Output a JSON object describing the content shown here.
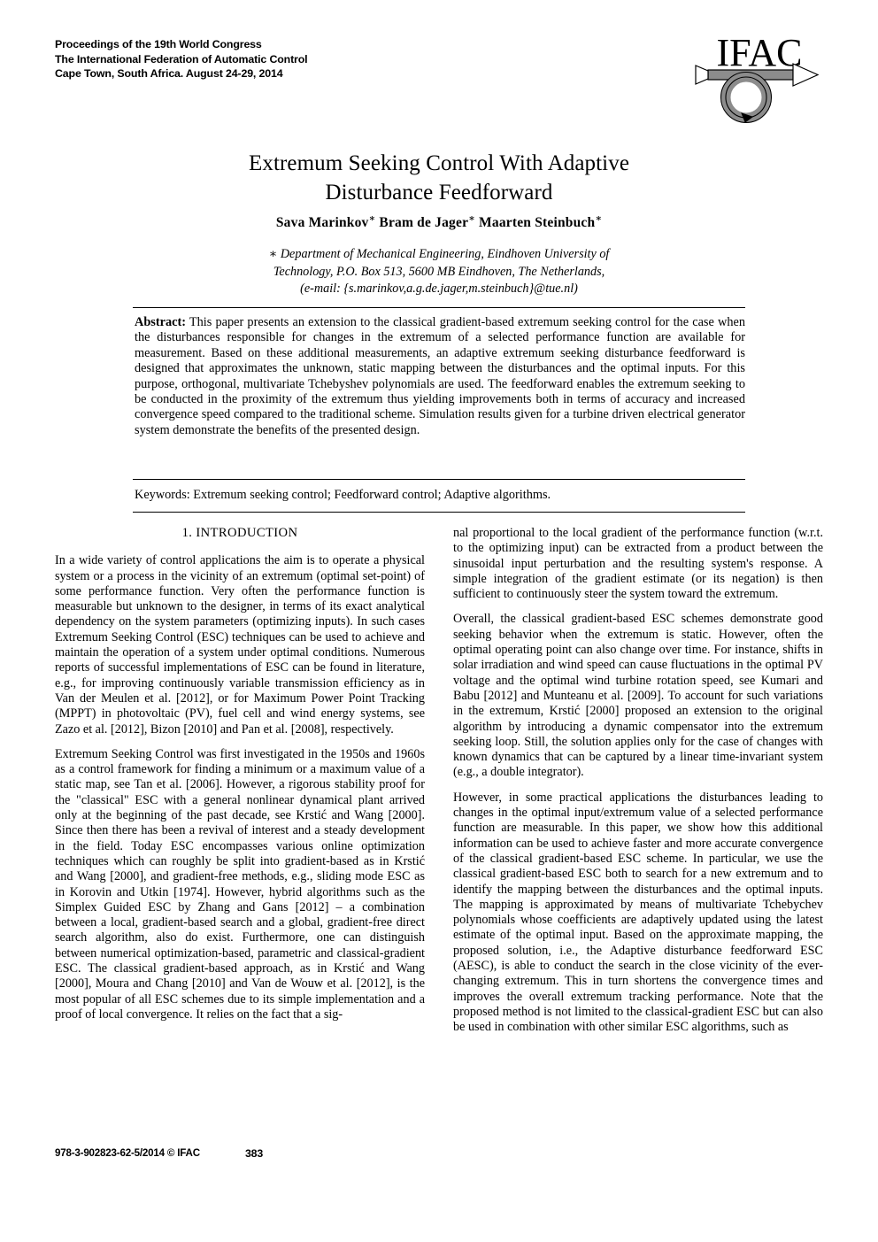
{
  "header": {
    "line1": "Proceedings of the 19th World Congress",
    "line2": "The International Federation of Automatic Control",
    "line3": "Cape Town, South Africa. August 24-29, 2014",
    "logo_text": "IFAC"
  },
  "title": {
    "line1": "Extremum Seeking Control With Adaptive",
    "line2": "Disturbance Feedforward"
  },
  "authors": {
    "list": "Sava Marinkov * Bram de Jager * Maarten Steinbuch *",
    "name1": "Sava Marinkov",
    "name2": "Bram de Jager",
    "name3": "Maarten Steinbuch",
    "marker": "∗"
  },
  "affiliation": {
    "line1": "∗ Department of Mechanical Engineering, Eindhoven University of",
    "line2": "Technology, P.O. Box 513, 5600 MB Eindhoven, The Netherlands,",
    "line3": "(e-mail: {s.marinkov,a.g.de.jager,m.steinbuch}@tue.nl)"
  },
  "abstract": {
    "label": "Abstract:",
    "text": " This paper presents an extension to the classical gradient-based extremum seeking control for the case when the disturbances responsible for changes in the extremum of a selected performance function are available for measurement. Based on these additional measurements, an adaptive extremum seeking disturbance feedforward is designed that approximates the unknown, static mapping between the disturbances and the optimal inputs. For this purpose, orthogonal, multivariate Tchebyshev polynomials are used. The feedforward enables the extremum seeking to be conducted in the proximity of the extremum thus yielding improvements both in terms of accuracy and increased convergence speed compared to the traditional scheme. Simulation results given for a turbine driven electrical generator system demonstrate the benefits of the presented design."
  },
  "keywords": {
    "text": "Keywords: Extremum seeking control; Feedforward control; Adaptive algorithms."
  },
  "left_column": {
    "section_heading": "1. INTRODUCTION",
    "paragraphs": [
      "In a wide variety of control applications the aim is to operate a physical system or a process in the vicinity of an extremum (optimal set-point) of some performance function. Very often the performance function is measurable but unknown to the designer, in terms of its exact analytical dependency on the system parameters (optimizing inputs). In such cases Extremum Seeking Control (ESC) techniques can be used to achieve and maintain the operation of a system under optimal conditions. Numerous reports of successful implementations of ESC can be found in literature, e.g., for improving continuously variable transmission efficiency as in Van der Meulen et al. [2012], or for Maximum Power Point Tracking (MPPT) in photovoltaic (PV), fuel cell and wind energy systems, see Zazo et al. [2012], Bizon [2010] and Pan et al. [2008], respectively.",
      "Extremum Seeking Control was first investigated in the 1950s and 1960s as a control framework for finding a minimum or a maximum value of a static map, see Tan et al. [2006]. However, a rigorous stability proof for the \"classical\" ESC with a general nonlinear dynamical plant arrived only at the beginning of the past decade, see Krstić and Wang [2000]. Since then there has been a revival of interest and a steady development in the field. Today ESC encompasses various online optimization techniques which can roughly be split into gradient-based as in Krstić and Wang [2000], and gradient-free methods, e.g., sliding mode ESC as in Korovin and Utkin [1974]. However, hybrid algorithms such as the Simplex Guided ESC by Zhang and Gans [2012] – a combination between a local, gradient-based search and a global, gradient-free direct search algorithm, also do exist. Furthermore, one can distinguish between numerical optimization-based, parametric and classical-gradient ESC. The classical gradient-based approach, as in Krstić and Wang [2000], Moura and Chang [2010] and Van de Wouw et al. [2012], is the most popular of all ESC schemes due to its simple implementation and a proof of local convergence. It relies on the fact that a sig-"
    ]
  },
  "right_column": {
    "paragraphs": [
      "nal proportional to the local gradient of the performance function (w.r.t. to the optimizing input) can be extracted from a product between the sinusoidal input perturbation and the resulting system's response. A simple integration of the gradient estimate (or its negation) is then sufficient to continuously steer the system toward the extremum.",
      "Overall, the classical gradient-based ESC schemes demonstrate good seeking behavior when the extremum is static. However, often the optimal operating point can also change over time. For instance, shifts in solar irradiation and wind speed can cause fluctuations in the optimal PV voltage and the optimal wind turbine rotation speed, see Kumari and Babu [2012] and Munteanu et al. [2009]. To account for such variations in the extremum, Krstić [2000] proposed an extension to the original algorithm by introducing a dynamic compensator into the extremum seeking loop. Still, the solution applies only for the case of changes with known dynamics that can be captured by a linear time-invariant system (e.g., a double integrator).",
      "However, in some practical applications the disturbances leading to changes in the optimal input/extremum value of a selected performance function are measurable. In this paper, we show how this additional information can be used to achieve faster and more accurate convergence of the classical gradient-based ESC scheme. In particular, we use the classical gradient-based ESC both to search for a new extremum and to identify the mapping between the disturbances and the optimal inputs. The mapping is approximated by means of multivariate Tchebychev polynomials whose coefficients are adaptively updated using the latest estimate of the optimal input. Based on the approximate mapping, the proposed solution, i.e., the Adaptive disturbance feedforward ESC (AESC), is able to conduct the search in the close vicinity of the ever-changing extremum. This in turn shortens the convergence times and improves the overall extremum tracking performance. Note that the proposed method is not limited to the classical-gradient ESC but can also be used in combination with other similar ESC algorithms, such as"
    ]
  },
  "footer": {
    "isbn": "978-3-902823-62-5/2014 © IFAC",
    "page_number": "383"
  },
  "colors": {
    "text": "#000000",
    "background": "#ffffff",
    "logo_gray": "#8c8c8c"
  }
}
